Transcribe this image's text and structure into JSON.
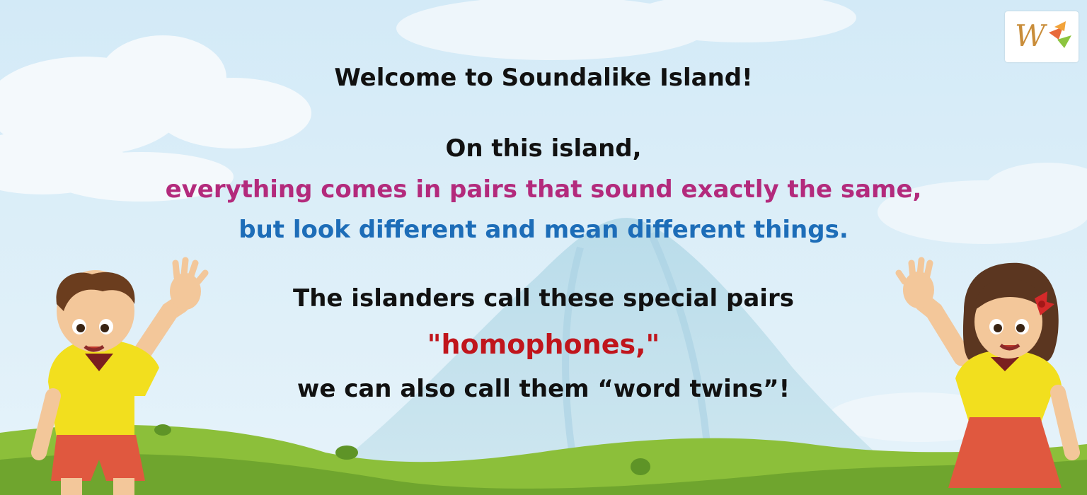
{
  "text": {
    "welcome": "Welcome to Soundalike Island!",
    "intro": "On this island,",
    "pairs_line": "everything comes in pairs that sound exactly the same,",
    "meaning_line": "but look different and mean different things.",
    "islanders_line": "The islanders call these special pairs",
    "homophones": "\"homophones,\"",
    "twins_line": "we can also call them “word twins”!"
  },
  "colors": {
    "sky": "#d9edf8",
    "text_dark": "#111111",
    "pink": "#b32a7c",
    "blue": "#1d6db8",
    "red": "#c0151c",
    "grass": "#8cbf3a",
    "shirt": "#f2df1e",
    "shorts": "#e0583f"
  },
  "icons": {
    "logo": "w-logo-icon",
    "boy": "waving-boy",
    "girl": "waving-girl"
  }
}
